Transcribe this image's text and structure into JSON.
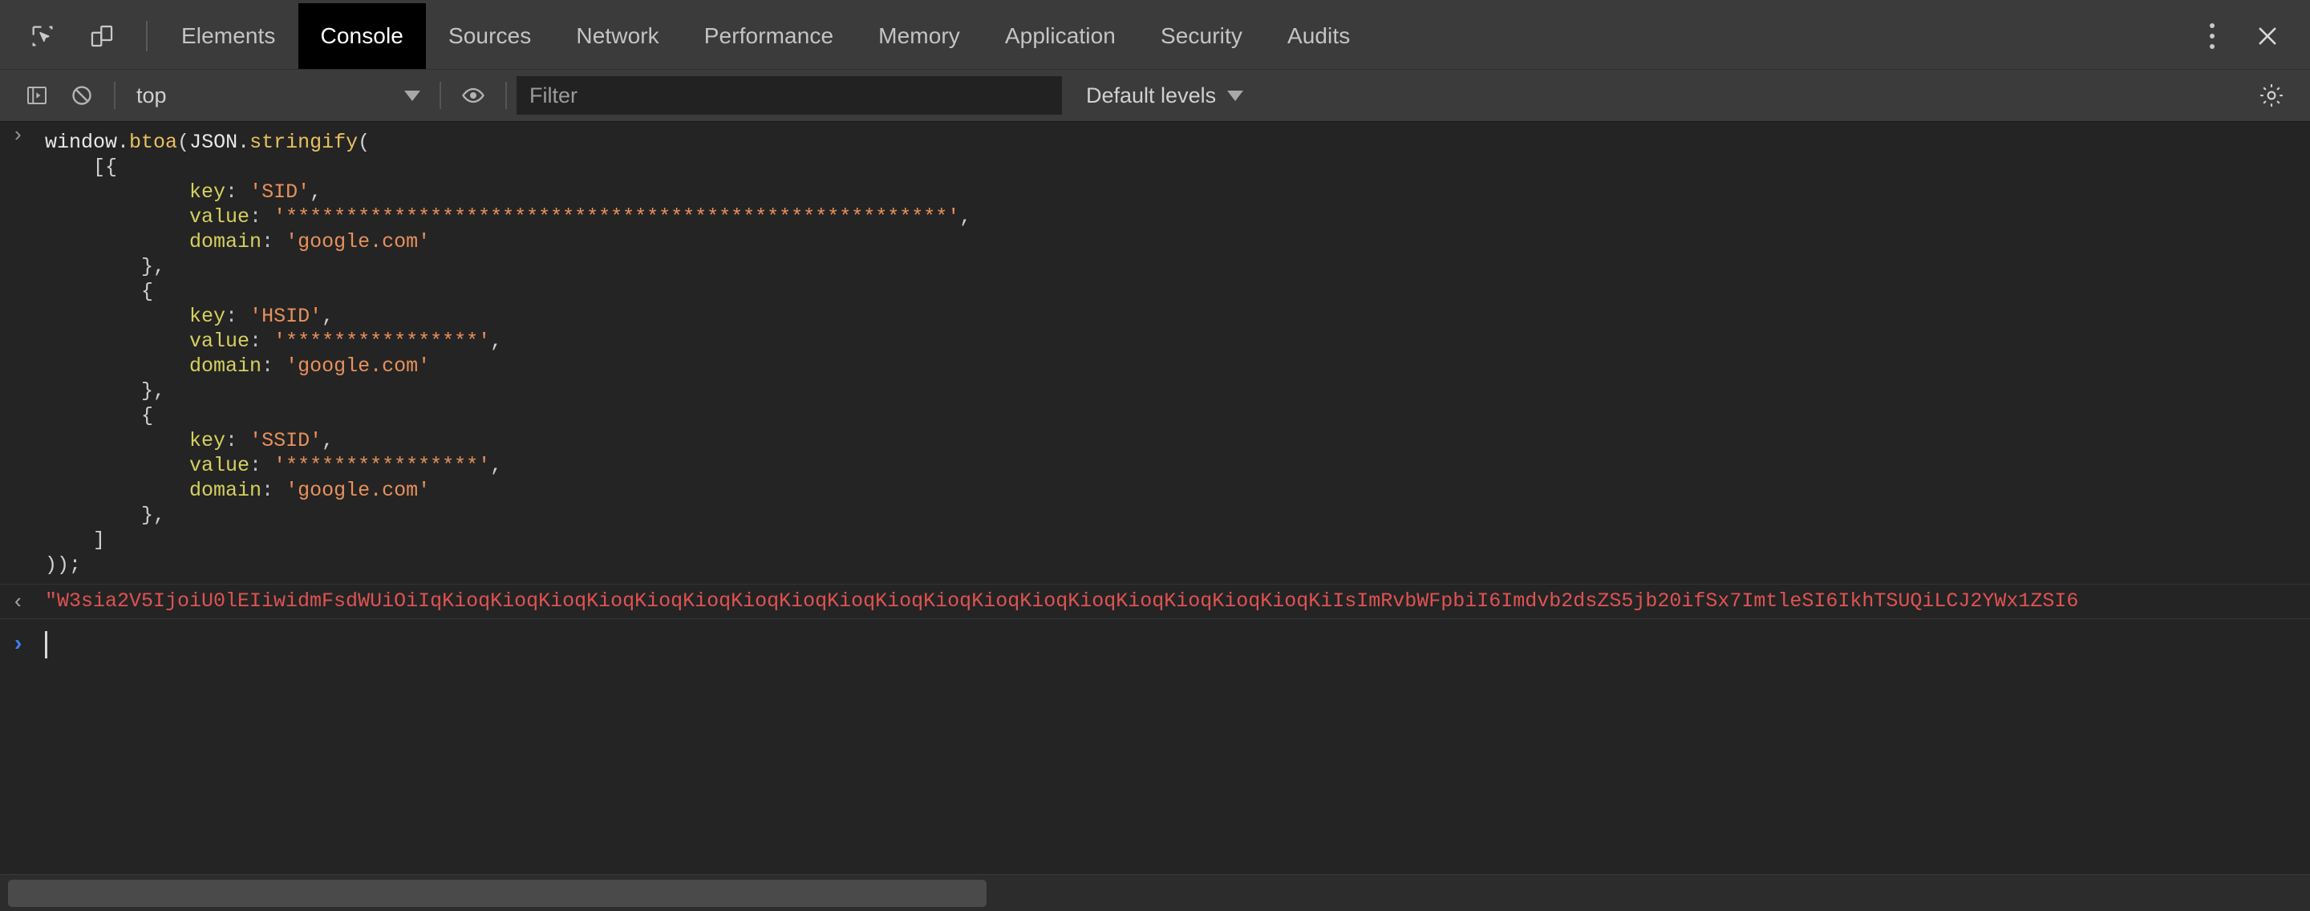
{
  "window": {
    "title": "Chrome DevTools",
    "theme_bg": "#242424",
    "toolbar_bg": "#3b3b3b",
    "accent": "#3b82f6"
  },
  "tabbar": {
    "inspect_icon": "inspect-element-icon",
    "device_icon": "device-toolbar-icon",
    "tabs": [
      {
        "label": "Elements",
        "active": false
      },
      {
        "label": "Console",
        "active": true
      },
      {
        "label": "Sources",
        "active": false
      },
      {
        "label": "Network",
        "active": false
      },
      {
        "label": "Performance",
        "active": false
      },
      {
        "label": "Memory",
        "active": false
      },
      {
        "label": "Application",
        "active": false
      },
      {
        "label": "Security",
        "active": false
      },
      {
        "label": "Audits",
        "active": false
      }
    ],
    "more_icon": "kebab-menu-icon",
    "close_icon": "close-icon"
  },
  "console_toolbar": {
    "sidebar_toggle_icon": "console-sidebar-icon",
    "clear_icon": "clear-console-icon",
    "context_label": "top",
    "context_caret_icon": "chevron-down-icon",
    "eye_icon": "live-expression-icon",
    "filter_placeholder": "Filter",
    "filter_value": "",
    "levels_label": "Default levels",
    "levels_caret_icon": "chevron-down-icon",
    "settings_icon": "gear-icon"
  },
  "console": {
    "input_gutter": "›",
    "output_gutter": "‹",
    "prompt_gutter": "›",
    "input_lines": [
      [
        {
          "t": "window",
          "c": "s-plain"
        },
        {
          "t": ".",
          "c": "s-punct"
        },
        {
          "t": "btoa",
          "c": "s-prop"
        },
        {
          "t": "(",
          "c": "s-punct"
        },
        {
          "t": "JSON",
          "c": "s-plain"
        },
        {
          "t": ".",
          "c": "s-punct"
        },
        {
          "t": "stringify",
          "c": "s-prop"
        },
        {
          "t": "(",
          "c": "s-punct"
        }
      ],
      [
        {
          "t": "    [{",
          "c": "s-punct"
        }
      ],
      [
        {
          "t": "            ",
          "c": "s-punct"
        },
        {
          "t": "key",
          "c": "s-key"
        },
        {
          "t": ":",
          "c": "s-colon"
        },
        {
          "t": " ",
          "c": "s-punct"
        },
        {
          "t": "'SID'",
          "c": "s-string"
        },
        {
          "t": ",",
          "c": "s-punct"
        }
      ],
      [
        {
          "t": "            ",
          "c": "s-punct"
        },
        {
          "t": "value",
          "c": "s-key"
        },
        {
          "t": ":",
          "c": "s-colon"
        },
        {
          "t": " ",
          "c": "s-punct"
        },
        {
          "t": "'*******************************************************'",
          "c": "s-string"
        },
        {
          "t": ",",
          "c": "s-punct"
        }
      ],
      [
        {
          "t": "            ",
          "c": "s-punct"
        },
        {
          "t": "domain",
          "c": "s-key"
        },
        {
          "t": ":",
          "c": "s-colon"
        },
        {
          "t": " ",
          "c": "s-punct"
        },
        {
          "t": "'google.com'",
          "c": "s-string"
        }
      ],
      [
        {
          "t": "        },",
          "c": "s-punct"
        }
      ],
      [
        {
          "t": "        {",
          "c": "s-punct"
        }
      ],
      [
        {
          "t": "            ",
          "c": "s-punct"
        },
        {
          "t": "key",
          "c": "s-key"
        },
        {
          "t": ":",
          "c": "s-colon"
        },
        {
          "t": " ",
          "c": "s-punct"
        },
        {
          "t": "'HSID'",
          "c": "s-string"
        },
        {
          "t": ",",
          "c": "s-punct"
        }
      ],
      [
        {
          "t": "            ",
          "c": "s-punct"
        },
        {
          "t": "value",
          "c": "s-key"
        },
        {
          "t": ":",
          "c": "s-colon"
        },
        {
          "t": " ",
          "c": "s-punct"
        },
        {
          "t": "'****************'",
          "c": "s-string"
        },
        {
          "t": ",",
          "c": "s-punct"
        }
      ],
      [
        {
          "t": "            ",
          "c": "s-punct"
        },
        {
          "t": "domain",
          "c": "s-key"
        },
        {
          "t": ":",
          "c": "s-colon"
        },
        {
          "t": " ",
          "c": "s-punct"
        },
        {
          "t": "'google.com'",
          "c": "s-string"
        }
      ],
      [
        {
          "t": "        },",
          "c": "s-punct"
        }
      ],
      [
        {
          "t": "        {",
          "c": "s-punct"
        }
      ],
      [
        {
          "t": "            ",
          "c": "s-punct"
        },
        {
          "t": "key",
          "c": "s-key"
        },
        {
          "t": ":",
          "c": "s-colon"
        },
        {
          "t": " ",
          "c": "s-punct"
        },
        {
          "t": "'SSID'",
          "c": "s-string"
        },
        {
          "t": ",",
          "c": "s-punct"
        }
      ],
      [
        {
          "t": "            ",
          "c": "s-punct"
        },
        {
          "t": "value",
          "c": "s-key"
        },
        {
          "t": ":",
          "c": "s-colon"
        },
        {
          "t": " ",
          "c": "s-punct"
        },
        {
          "t": "'****************'",
          "c": "s-string"
        },
        {
          "t": ",",
          "c": "s-punct"
        }
      ],
      [
        {
          "t": "            ",
          "c": "s-punct"
        },
        {
          "t": "domain",
          "c": "s-key"
        },
        {
          "t": ":",
          "c": "s-colon"
        },
        {
          "t": " ",
          "c": "s-punct"
        },
        {
          "t": "'google.com'",
          "c": "s-string"
        }
      ],
      [
        {
          "t": "        },",
          "c": "s-punct"
        }
      ],
      [
        {
          "t": "    ]",
          "c": "s-punct"
        }
      ],
      [
        {
          "t": "));",
          "c": "s-punct"
        }
      ]
    ],
    "output_text": "\"W3sia2V5IjoiU0lEIiwidmFsdWUiOiIqKioqKioqKioqKioqKioqKioqKioqKioqKioqKioqKioqKioqKioqKioqKioqKioqKioqKioqKiIsImRvbWFpbiI6Imdvb2dsZS5jb20ifSx7ImtleSI6IkhTSUQiLCJ2YWx1ZSI6",
    "prompt_value": ""
  },
  "scrollbar": {
    "orientation": "horizontal",
    "thumb_label": "horizontal-scroll-thumb"
  }
}
